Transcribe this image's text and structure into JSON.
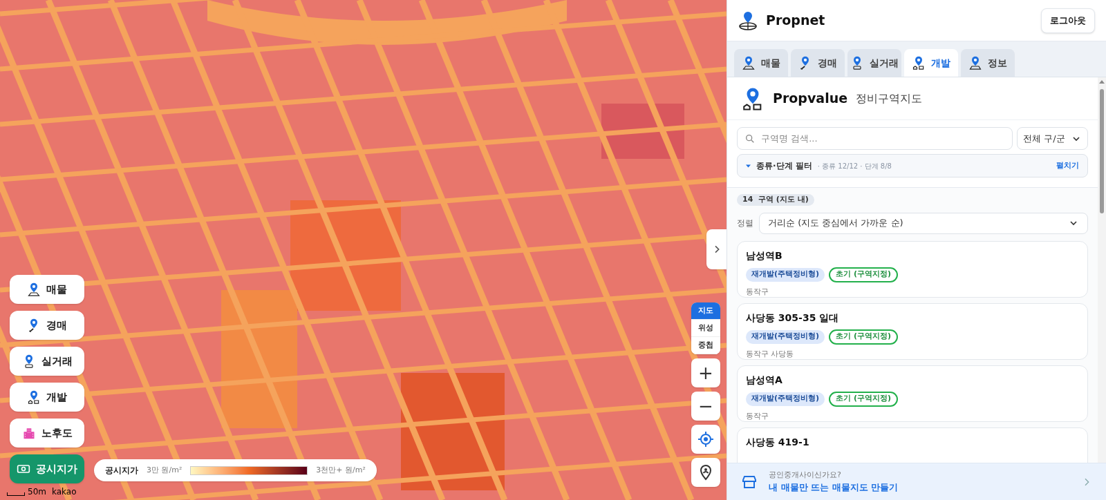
{
  "map": {
    "layer_buttons": [
      {
        "label": "매물",
        "kind": "listing",
        "selected": false
      },
      {
        "label": "경매",
        "kind": "auction",
        "selected": false
      },
      {
        "label": "실거래",
        "kind": "transaction",
        "selected": false
      },
      {
        "label": "개발",
        "kind": "development",
        "selected": false
      },
      {
        "label": "노후도",
        "kind": "aging",
        "selected": false
      },
      {
        "label": "공시지가",
        "kind": "land-price",
        "selected": true
      }
    ],
    "legend": {
      "title": "공시지가",
      "min": "3만 원/m²",
      "max": "3천만+ 원/m²"
    },
    "scale": "50m",
    "attribution": "kakao",
    "map_types": [
      {
        "label": "지도",
        "selected": true
      },
      {
        "label": "위성",
        "selected": false
      },
      {
        "label": "중첩",
        "selected": false
      }
    ],
    "zoom_in": "+",
    "zoom_out": "−"
  },
  "panel": {
    "brand": "Propnet",
    "logout": "로그아웃",
    "tabs": [
      {
        "label": "매물",
        "kind": "listing",
        "selected": false
      },
      {
        "label": "경매",
        "kind": "auction",
        "selected": false
      },
      {
        "label": "실거래",
        "kind": "transaction",
        "selected": false
      },
      {
        "label": "개발",
        "kind": "development",
        "selected": true
      },
      {
        "label": "정보",
        "kind": "info",
        "selected": false
      }
    ],
    "title": "Propvalue",
    "subtitle": "정비구역지도",
    "search": {
      "placeholder": "구역명 검색..."
    },
    "district_select": "전체 구/군",
    "filter": {
      "expanded": false,
      "label": "종류·단계 필터",
      "summary": "· 종류 12/12 · 단계 8/8",
      "action": "펼치기"
    },
    "count": "14  구역 (지도 내)",
    "sort": {
      "label": "정렬",
      "value": "거리순 (지도 중심에서 가까운 순)"
    },
    "zones": [
      {
        "name": "남성역B",
        "tags": [
          {
            "label": "재개발(주택정비형)",
            "kind": "type"
          },
          {
            "label": "초기 (구역지정)",
            "kind": "stage"
          }
        ],
        "location": "동작구"
      },
      {
        "name": "사당동 305-35 일대",
        "tags": [
          {
            "label": "재개발(주택정비형)",
            "kind": "type"
          },
          {
            "label": "초기 (구역지정)",
            "kind": "stage"
          }
        ],
        "location": "동작구 사당동"
      },
      {
        "name": "남성역A",
        "tags": [
          {
            "label": "재개발(주택정비형)",
            "kind": "type"
          },
          {
            "label": "초기 (구역지정)",
            "kind": "stage"
          }
        ],
        "location": "동작구"
      },
      {
        "name": "사당동 419-1"
      }
    ],
    "banner": {
      "question": "공인중개사이신가요?",
      "action": "내 매물만 뜨는 매물지도 만들기"
    }
  }
}
